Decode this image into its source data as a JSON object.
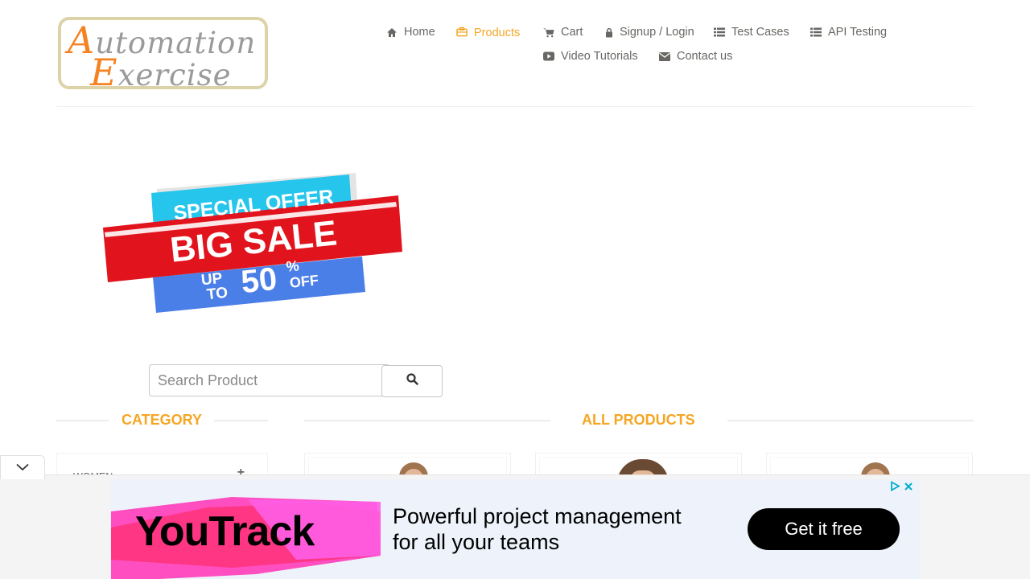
{
  "logo": {
    "line1_cap": "A",
    "line1_rest": "utomation",
    "line2_cap": "E",
    "line2_rest": "xercise"
  },
  "nav": [
    {
      "label": "Home",
      "icon": "home-icon"
    },
    {
      "label": "Products",
      "icon": "products-icon",
      "active": true
    },
    {
      "label": "Cart",
      "icon": "cart-icon"
    },
    {
      "label": "Signup / Login",
      "icon": "lock-icon"
    },
    {
      "label": "Test Cases",
      "icon": "list-icon"
    },
    {
      "label": "API Testing",
      "icon": "list-icon"
    },
    {
      "label": "Video Tutorials",
      "icon": "youtube-icon"
    },
    {
      "label": "Contact us",
      "icon": "envelope-icon"
    }
  ],
  "banner": {
    "line1": "SPECIAL OFFER",
    "line2": "BIG SALE",
    "up": "UP",
    "to": "TO",
    "percent": "50",
    "percent_sign": "%",
    "off": "OFF"
  },
  "search": {
    "placeholder": "Search Product",
    "value": ""
  },
  "sections": {
    "category": "CATEGORY",
    "all_products": "ALL PRODUCTS"
  },
  "categories": [
    {
      "label": "WOMEN",
      "toggle": "+"
    }
  ],
  "ad": {
    "brand": "YouTrack",
    "line1": "Powerful project management",
    "line2": "for all your teams",
    "cta": "Get it free"
  },
  "colors": {
    "accent": "#F5A623",
    "text": "#696763",
    "ad_bg": "#EEF3FB"
  }
}
